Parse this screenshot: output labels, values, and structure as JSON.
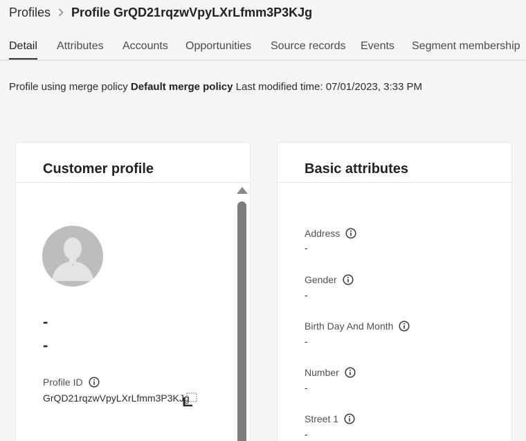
{
  "breadcrumb": {
    "root": "Profiles",
    "current": "Profile GrQD21rqzwVpyLXrLfmm3P3KJg"
  },
  "tabs": [
    {
      "label": "Detail",
      "active": true
    },
    {
      "label": "Attributes"
    },
    {
      "label": "Accounts"
    },
    {
      "label": "Opportunities"
    },
    {
      "label": "Source records"
    },
    {
      "label": "Events"
    },
    {
      "label": "Segment membership"
    }
  ],
  "merge": {
    "prefix": "Profile using merge policy",
    "policy": "Default merge policy",
    "modified": "Last modified time: 07/01/2023, 3:33 PM"
  },
  "customer_profile": {
    "title": "Customer profile",
    "name_line1": "-",
    "name_line2": "-",
    "profile_id_label": "Profile ID",
    "profile_id_value": "GrQD21rqzwVpyLXrLfmm3P3KJg"
  },
  "basic_attributes": {
    "title": "Basic attributes",
    "fields": [
      {
        "label": "Address",
        "value": "-"
      },
      {
        "label": "Gender",
        "value": "-"
      },
      {
        "label": "Birth Day And Month",
        "value": "-"
      },
      {
        "label": "Number",
        "value": "-"
      },
      {
        "label": "Street 1",
        "value": "-"
      }
    ]
  },
  "colors": {
    "background": "#f5f5f5",
    "card": "#ffffff",
    "text": "#2c2c2c",
    "avatar": "#bdbdbd",
    "scrollbar": "#7d7d7d"
  },
  "icons": {
    "breadcrumb_separator": "chevron-right-icon",
    "info": "info-icon",
    "copy": "copy-icon",
    "avatar": "person-silhouette-icon"
  }
}
